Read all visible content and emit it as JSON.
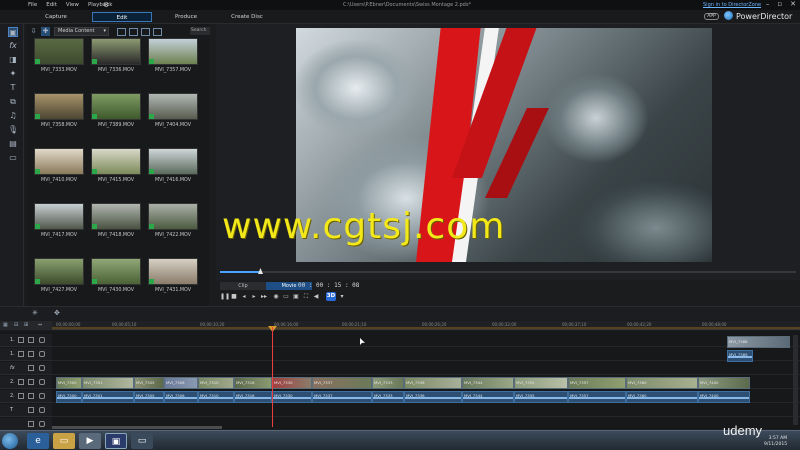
{
  "menu": [
    "File",
    "Edit",
    "View",
    "Playback"
  ],
  "file_path": "C:\\Users\\P.Ebner\\Documents\\Swiss Montage 2.pds*",
  "signin": "Sign in to DirectorZone",
  "modes": [
    {
      "label": "Capture"
    },
    {
      "label": "Edit"
    },
    {
      "label": "Produce"
    },
    {
      "label": "Create Disc"
    }
  ],
  "app_badge": "APP",
  "app_name": "PowerDirector",
  "library": {
    "dropdown": "Media Content",
    "search": "Search",
    "thumbs": [
      "MVI_7333.MOV",
      "MVI_7336.MOV",
      "MVI_7357.MOV",
      "MVI_7358.MOV",
      "MVI_7389.MOV",
      "MVI_7404.MOV",
      "MVI_7410.MOV",
      "MVI_7415.MOV",
      "MVI_7416.MOV",
      "MVI_7417.MOV",
      "MVI_7418.MOV",
      "MVI_7422.MOV",
      "MVI_7427.MOV",
      "MVI_7430.MOV",
      "MVI_7431.MOV"
    ]
  },
  "preview": {
    "clip_label": "Clip",
    "movie_label": "Movie",
    "timecode": "00 : 00 : 15 : 08",
    "three_d": "3D"
  },
  "ruler_ticks": [
    "00;00;00;00",
    "00;00;05;10",
    "00;00;10;20",
    "00;00;16;00",
    "00;00;21;10",
    "00;00;26;20",
    "00;00;32;00",
    "00;00;37;10",
    "00;00;42;20",
    "00;00;48;00"
  ],
  "tracks": [
    {
      "name": "1."
    },
    {
      "name": "1."
    },
    {
      "name": "fx"
    },
    {
      "name": "2."
    },
    {
      "name": "2."
    },
    {
      "name": "T"
    },
    {
      "name": ""
    }
  ],
  "clips_top": [
    "MVI_7388",
    "MVI_7389"
  ],
  "video_clips": [
    "MVI_7300",
    "MVI_7301",
    "MVI_7305",
    "MVI_7306",
    "MVI_7310",
    "MVI_7316",
    "MVI_7330",
    "MVI_7337",
    "MVI_7333",
    "MVI_7336",
    "MVI_7344",
    "MVI_7355",
    "MVI_7357",
    "MVI_7360",
    "MVI_7400"
  ],
  "audio_clips": [
    "MVI_7300",
    "MVI_7301",
    "MVI_7305",
    "MVI_7306",
    "MVI_7310",
    "MVI_7316",
    "MVI_7330",
    "MVI_7337",
    "MVI_7333",
    "MVI_7336",
    "MVI_7344",
    "MVI_7355",
    "MVI_7357",
    "MVI_7360",
    "MVI_7400"
  ],
  "watermark": "www.cgtsj.com",
  "udemy": "udemy",
  "clock": {
    "time": "3:57 AM",
    "date": "9/11/2015"
  },
  "colors": {
    "accent": "#3a78b8",
    "flag_red": "#d8161a",
    "watermark": "#f2e81a"
  }
}
